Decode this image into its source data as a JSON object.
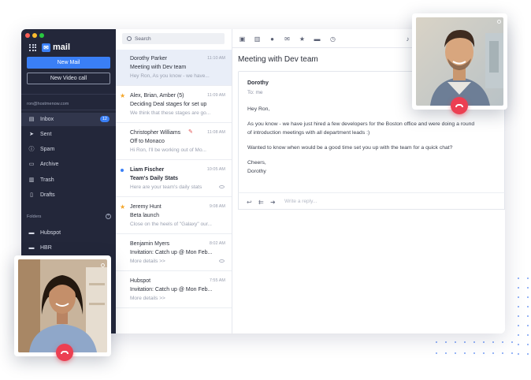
{
  "window": {
    "traffic_lights": [
      "#ff5f57",
      "#febc2e",
      "#28c840"
    ]
  },
  "brand": {
    "name": "mail",
    "color": "#3a7ff6"
  },
  "sidebar": {
    "new_mail": "New Mail",
    "new_video_call": "New Video call",
    "account": "ron@hostmenow.com",
    "items": [
      {
        "label": "Inbox",
        "icon": "inbox-icon",
        "badge": "12",
        "active": true
      },
      {
        "label": "Sent",
        "icon": "send-icon"
      },
      {
        "label": "Spam",
        "icon": "spam-icon"
      },
      {
        "label": "Archive",
        "icon": "archive-icon"
      },
      {
        "label": "Trash",
        "icon": "trash-icon"
      },
      {
        "label": "Drafts",
        "icon": "drafts-icon"
      }
    ],
    "folders_header": "Folders",
    "folders": [
      {
        "label": "Hubspot",
        "icon": "folder-icon"
      },
      {
        "label": "HBR",
        "icon": "folder-icon"
      }
    ]
  },
  "search": {
    "placeholder": "Search"
  },
  "emails": [
    {
      "from": "Dorothy Parker",
      "time": "11:10 AM",
      "subject": "Meeting with Dev team",
      "preview": "Hey Ron, As you know - we have...",
      "selected": true
    },
    {
      "from": "Alex, Brian, Amber (5)",
      "time": "11:09 AM",
      "subject": "Deciding Deal stages for set up",
      "preview": "We think that these stages are go...",
      "starred": true
    },
    {
      "from": "Christopher Williams",
      "time": "11:08 AM",
      "subject": "Off to Monaco",
      "preview": "Hi Ron, I'll be working out of Mo...",
      "draft_marker": true
    },
    {
      "from": "Liam Fischer",
      "time": "10:05 AM",
      "subject": "Team's Daily Stats",
      "preview": "Here are your team's daily stats",
      "unread": true,
      "read_receipt": true
    },
    {
      "from": "Jeremy Hunt",
      "time": "9:08 AM",
      "subject": "Beta launch",
      "preview": "Close on the heels of \"Galaxy\" our...",
      "starred": true
    },
    {
      "from": "Benjamin Myers",
      "time": "8:02 AM",
      "subject": "Invitation: Catch up @ Mon Feb...",
      "preview": "More details >>",
      "read_receipt": true
    },
    {
      "from": "Hubspot",
      "time": "7:55 AM",
      "subject": "Invitation: Catch up @ Mon Feb...",
      "preview": "More details >>"
    }
  ],
  "toolbar_icons": [
    "archive-icon",
    "trash-icon",
    "spam-icon",
    "mail-icon",
    "star-icon",
    "folder-icon",
    "clock-icon",
    "bell-icon"
  ],
  "reading": {
    "title": "Meeting with Dev team",
    "sender": "Dorothy",
    "to": "To: me",
    "body": [
      "Hey Ron,",
      "As you know - we have just hired a few developers for the Boston office and were doing a round",
      "of introduction meetings with all department leads :)",
      "Wanted to know when would be a good time set you up with the team for a quick chat?",
      "Cheers,",
      "Dorothy"
    ],
    "reply_placeholder": "Write a reply..."
  },
  "video_calls": [
    {
      "position": "top-right",
      "person": "male caller"
    },
    {
      "position": "bottom-left",
      "person": "female caller"
    }
  ],
  "colors": {
    "accent": "#3a7ff6",
    "sidebar_bg": "#23273a",
    "hangup": "#ec3f52",
    "star": "#f4a62a"
  }
}
